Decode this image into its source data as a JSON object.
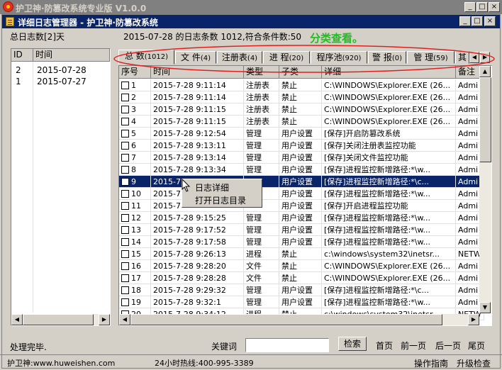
{
  "app": {
    "title": "护卫神·防篡改系统专业版 V1.0.0",
    "min": "_",
    "max": "□",
    "close": "×"
  },
  "dialog": {
    "title": "详细日志管理器 - 护卫神·防篡改系统",
    "min": "_",
    "max": "□",
    "close": "×"
  },
  "summary": {
    "total_days": "总日志数[2]天",
    "day_info": "2015-07-28 的日志条数 1012,符合条件数:50",
    "annotation": "分类查看。"
  },
  "days": {
    "headers": [
      "ID",
      "时间"
    ],
    "rows": [
      [
        "2",
        "2015-07-28"
      ],
      [
        "1",
        "2015-07-27"
      ]
    ]
  },
  "tabs": [
    {
      "label": "总 数",
      "count": "(1012)"
    },
    {
      "label": "文 件",
      "count": "(4)"
    },
    {
      "label": "注册表",
      "count": "(4)"
    },
    {
      "label": "进 程",
      "count": "(20)"
    },
    {
      "label": "程序池",
      "count": "(920)"
    },
    {
      "label": "警 报",
      "count": "(0)"
    },
    {
      "label": "管 理",
      "count": "(59)"
    },
    {
      "label": "其",
      "count": ""
    }
  ],
  "table": {
    "headers": [
      "序号",
      "时间",
      "类型",
      "子类",
      "详细",
      "备注"
    ],
    "rows": [
      [
        "1",
        "2015-7-28 9:11:14",
        "注册表",
        "禁止",
        "C:\\WINDOWS\\Explorer.EXE (26...",
        "Admi"
      ],
      [
        "2",
        "2015-7-28 9:11:14",
        "注册表",
        "禁止",
        "C:\\WINDOWS\\Explorer.EXE (26...",
        "Admi"
      ],
      [
        "3",
        "2015-7-28 9:11:15",
        "注册表",
        "禁止",
        "C:\\WINDOWS\\Explorer.EXE (26...",
        "Admi"
      ],
      [
        "4",
        "2015-7-28 9:11:15",
        "注册表",
        "禁止",
        "C:\\WINDOWS\\Explorer.EXE (26...",
        "Admi"
      ],
      [
        "5",
        "2015-7-28 9:12:54",
        "管理",
        "用户设置",
        "[保存]开启防篡改系统",
        "Admi"
      ],
      [
        "6",
        "2015-7-28 9:13:11",
        "管理",
        "用户设置",
        "[保存]关闭注册表监控功能",
        "Admi"
      ],
      [
        "7",
        "2015-7-28 9:13:14",
        "管理",
        "用户设置",
        "[保存]关闭文件监控功能",
        "Admi"
      ],
      [
        "8",
        "2015-7-28 9:13:34",
        "管理",
        "用户设置",
        "[保存]进程监控新增路径:*\\w...",
        "Admi"
      ],
      [
        "9",
        "2015-7",
        "",
        "用户设置",
        "[保存]进程监控新增路径:*\\c...",
        "Admi"
      ],
      [
        "10",
        "2015-7",
        "",
        "用户设置",
        "[保存]进程监控新增路径:*\\w...",
        "Admi"
      ],
      [
        "11",
        "2015-7",
        "",
        "用户设置",
        "[保存]开启进程监控功能",
        "Admi"
      ],
      [
        "12",
        "2015-7-28 9:15:25",
        "管理",
        "用户设置",
        "[保存]进程监控新增路径:*\\w...",
        "Admi"
      ],
      [
        "13",
        "2015-7-28 9:17:52",
        "管理",
        "用户设置",
        "[保存]进程监控新增路径:*\\w...",
        "Admi"
      ],
      [
        "14",
        "2015-7-28 9:17:58",
        "管理",
        "用户设置",
        "[保存]进程监控新增路径:*\\w...",
        "Admi"
      ],
      [
        "15",
        "2015-7-28 9:26:13",
        "进程",
        "禁止",
        "c:\\windows\\system32\\inetsr...",
        "NETW"
      ],
      [
        "16",
        "2015-7-28 9:28:20",
        "文件",
        "禁止",
        "C:\\WINDOWS\\Explorer.EXE (26...",
        "Admi"
      ],
      [
        "17",
        "2015-7-28 9:28:28",
        "文件",
        "禁止",
        "C:\\WINDOWS\\Explorer.EXE (26...",
        "Admi"
      ],
      [
        "18",
        "2015-7-28 9:29:32",
        "管理",
        "用户设置",
        "[保存]进程监控新增路径:*\\c...",
        "Admi"
      ],
      [
        "19",
        "2015-7-28 9:32:1",
        "管理",
        "用户设置",
        "[保存]进程监控新增路径:*\\w...",
        "Admi"
      ],
      [
        "20",
        "2015-7-28 9:34:12",
        "进程",
        "禁止",
        "c:\\windows\\system32\\inetsr...",
        "NETW"
      ]
    ]
  },
  "context_menu": [
    "日志详细",
    "打开日志目录"
  ],
  "bottom": {
    "status": "处理完毕.",
    "keyword_label": "关键词",
    "search": "检索",
    "first": "首页",
    "prev": "前一页",
    "next": "后一页",
    "last": "尾页"
  },
  "footer": {
    "site": "护卫神:www.huweishen.com",
    "hotline": "24小时热线:400-995-3389",
    "guide": "操作指南",
    "upgrade": "升级检查"
  },
  "colors": {
    "selection": "#0a246a",
    "annotation": "#20c020",
    "oval": "#e02020"
  }
}
